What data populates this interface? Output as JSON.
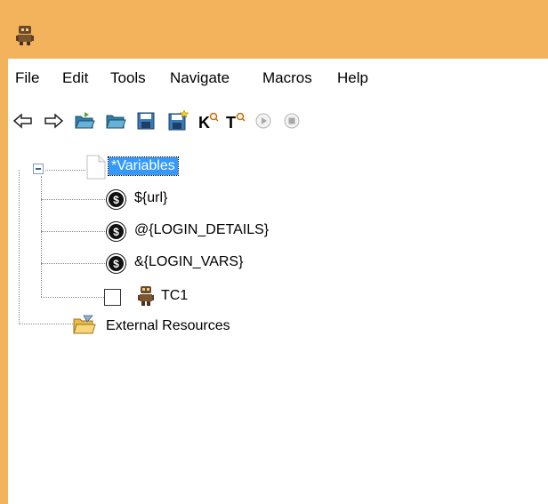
{
  "menu": {
    "file": "File",
    "edit": "Edit",
    "tools": "Tools",
    "navigate": "Navigate",
    "macros": "Macros",
    "help": "Help"
  },
  "toolbar": {
    "icons": [
      "back-arrow-icon",
      "forward-arrow-icon",
      "open-folder-icon",
      "folder-icon",
      "save-icon",
      "save-all-icon",
      "search-keywords-icon",
      "search-tests-icon",
      "run-icon",
      "stop-icon"
    ]
  },
  "tree": {
    "root": {
      "label": "*Variables"
    },
    "variables": [
      {
        "label": "${url}"
      },
      {
        "label": "@{LOGIN_DETAILS}"
      },
      {
        "label": "&{LOGIN_VARS}"
      }
    ],
    "testcase": {
      "label": "TC1"
    },
    "external": {
      "label": "External Resources"
    }
  },
  "colors": {
    "title_bar": "#f3b35c",
    "selection": "#3399ff"
  }
}
